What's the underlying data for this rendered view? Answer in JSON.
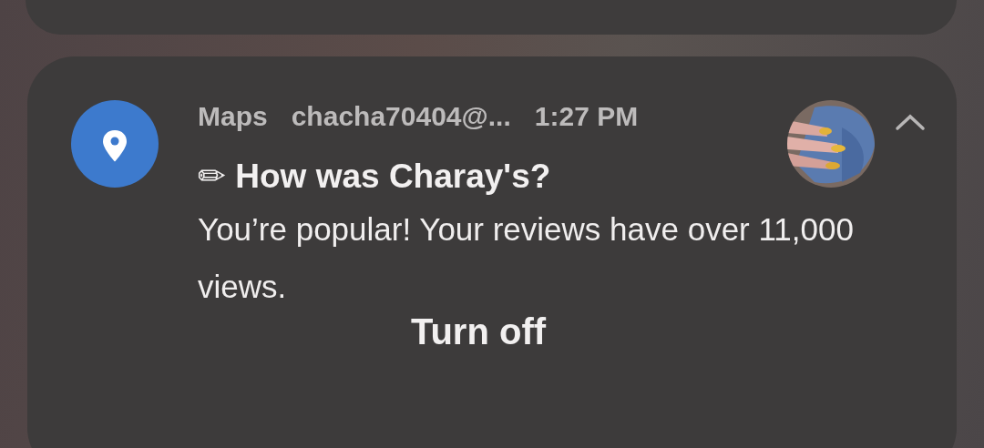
{
  "notification": {
    "app": "Maps",
    "account": "chacha70404@...",
    "time": "1:27 PM",
    "expanded": true,
    "title": "✏ How was Charay's?",
    "body": "You’re popular! Your reviews have over 11,000 views.",
    "actions": [
      "Turn off"
    ]
  }
}
